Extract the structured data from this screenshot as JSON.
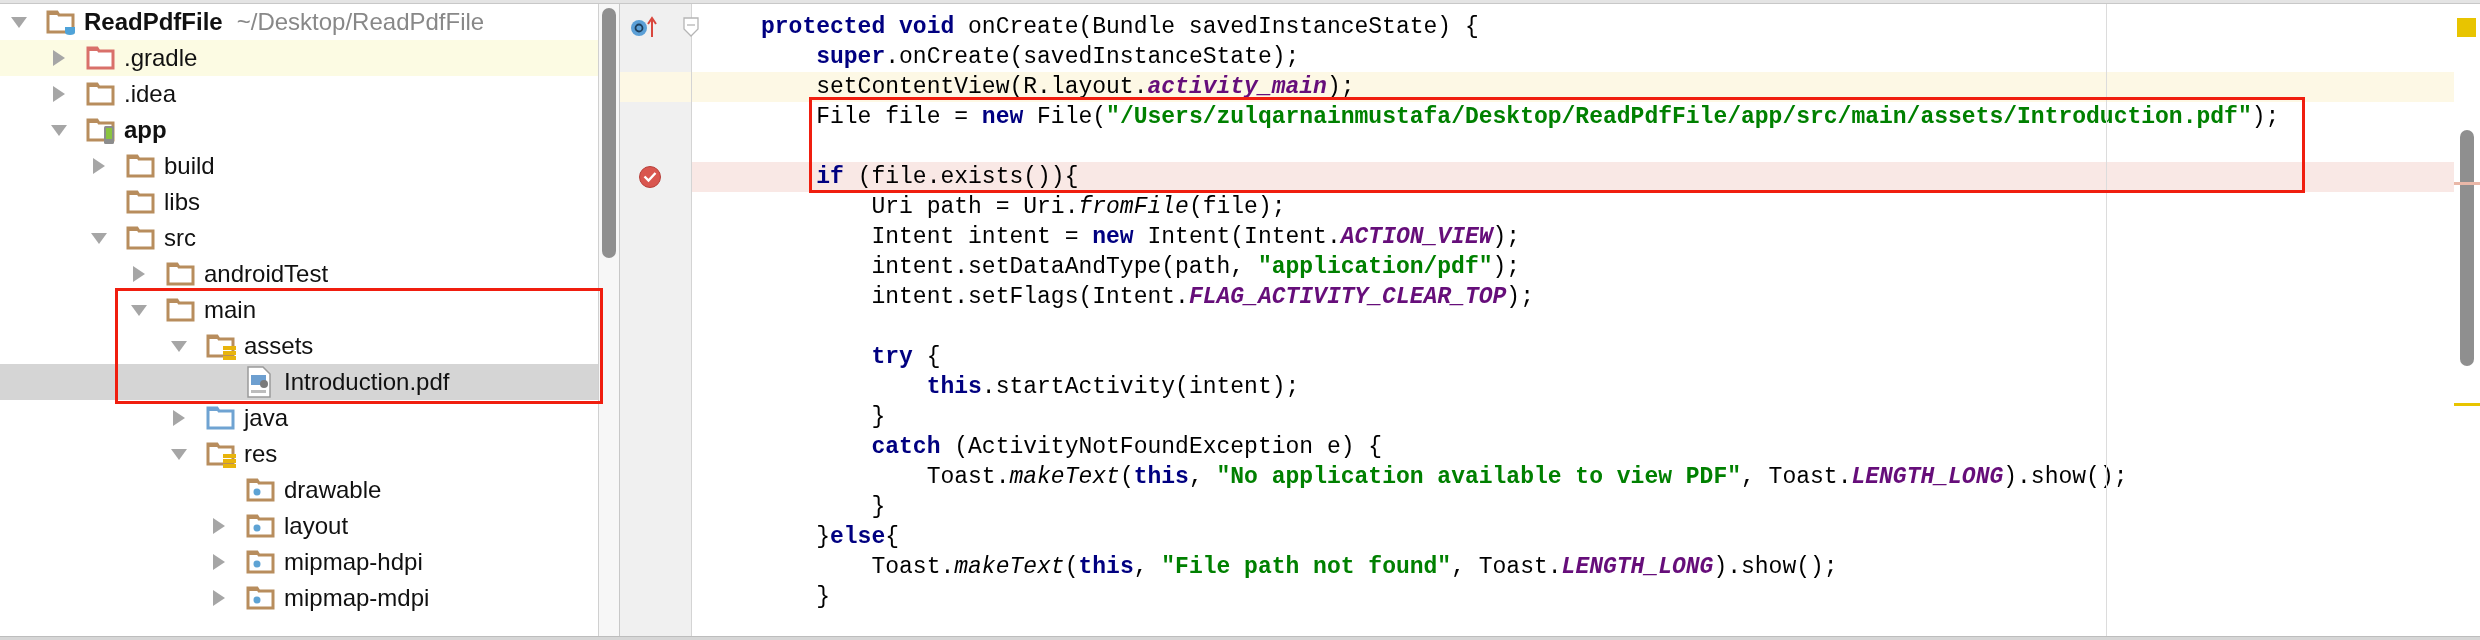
{
  "project_tree": [
    {
      "label": "ReadPdfFile",
      "path": "~/Desktop/ReadPdfFile",
      "kind": "project",
      "expanded": true,
      "selected": false,
      "highlighted": false,
      "boxed": false,
      "children": [
        {
          "label": ".gradle",
          "kind": "excluded",
          "expanded": false,
          "selected": false,
          "highlighted": true,
          "boxed": false
        },
        {
          "label": ".idea",
          "kind": "folder",
          "expanded": false,
          "selected": false,
          "highlighted": false,
          "boxed": false
        },
        {
          "label": "app",
          "kind": "module",
          "expanded": true,
          "selected": false,
          "highlighted": false,
          "boxed": false,
          "children": [
            {
              "label": "build",
              "kind": "folder",
              "expanded": false,
              "selected": false,
              "highlighted": false,
              "boxed": false
            },
            {
              "label": "libs",
              "kind": "folder",
              "selected": false,
              "highlighted": false,
              "boxed": false
            },
            {
              "label": "src",
              "kind": "folder",
              "expanded": true,
              "selected": false,
              "highlighted": false,
              "boxed": false,
              "children": [
                {
                  "label": "androidTest",
                  "kind": "folder",
                  "expanded": false,
                  "selected": false,
                  "highlighted": false,
                  "boxed": false
                },
                {
                  "label": "main",
                  "kind": "folder",
                  "expanded": true,
                  "selected": false,
                  "highlighted": false,
                  "boxed": true,
                  "children": [
                    {
                      "label": "assets",
                      "kind": "resources",
                      "expanded": true,
                      "selected": false,
                      "highlighted": false,
                      "boxed": true,
                      "children": [
                        {
                          "label": "Introduction.pdf",
                          "kind": "pdf",
                          "selected": true,
                          "highlighted": false,
                          "boxed": true
                        }
                      ]
                    },
                    {
                      "label": "java",
                      "kind": "source",
                      "expanded": false,
                      "selected": false,
                      "highlighted": false,
                      "boxed": false
                    },
                    {
                      "label": "res",
                      "kind": "resources",
                      "expanded": true,
                      "selected": false,
                      "highlighted": false,
                      "boxed": false,
                      "children": [
                        {
                          "label": "drawable",
                          "kind": "resdir",
                          "selected": false,
                          "highlighted": false,
                          "boxed": false
                        },
                        {
                          "label": "layout",
                          "kind": "resdir",
                          "expanded": false,
                          "selected": false,
                          "highlighted": false,
                          "boxed": false
                        },
                        {
                          "label": "mipmap-hdpi",
                          "kind": "resdir",
                          "expanded": false,
                          "selected": false,
                          "highlighted": false,
                          "boxed": false
                        },
                        {
                          "label": "mipmap-mdpi",
                          "kind": "resdir",
                          "expanded": false,
                          "selected": false,
                          "highlighted": false,
                          "boxed": false
                        }
                      ]
                    }
                  ]
                }
              ]
            }
          ]
        }
      ]
    }
  ],
  "editor": {
    "lines": [
      {
        "kind": "override",
        "boxed": false,
        "tokens": [
          {
            "text": "protected void",
            "kind": "keyword"
          },
          {
            "text": " onCreate(Bundle savedInstanceState) {",
            "kind": "plain"
          }
        ]
      },
      {
        "kind": "normal",
        "boxed": false,
        "tokens": [
          {
            "text": "    super",
            "kind": "keyword"
          },
          {
            "text": ".onCreate(savedInstanceState);",
            "kind": "plain"
          }
        ]
      },
      {
        "kind": "caret",
        "boxed": false,
        "tokens": [
          {
            "text": "    setContentView(R.layout.",
            "kind": "plain"
          },
          {
            "text": "activity_main",
            "kind": "field"
          },
          {
            "text": ");",
            "kind": "plain"
          }
        ]
      },
      {
        "kind": "normal",
        "boxed": true,
        "tokens": [
          {
            "text": "    File file = ",
            "kind": "plain"
          },
          {
            "text": "new",
            "kind": "keyword"
          },
          {
            "text": " File(",
            "kind": "plain"
          },
          {
            "text": "\"/Users/zulqarnainmustafa/Desktop/ReadPdfFile/app/src/main/assets/Introduction.pdf\"",
            "kind": "string"
          },
          {
            "text": ");",
            "kind": "plain"
          }
        ]
      },
      {
        "kind": "normal",
        "boxed": true
      },
      {
        "kind": "breakpoint",
        "boxed": true,
        "tokens": [
          {
            "text": "    if",
            "kind": "keyword"
          },
          {
            "text": " (file.exists()){",
            "kind": "plain"
          }
        ]
      },
      {
        "kind": "normal",
        "boxed": false,
        "tokens": [
          {
            "text": "        Uri path = Uri.",
            "kind": "plain"
          },
          {
            "text": "fromFile",
            "kind": "method"
          },
          {
            "text": "(file);",
            "kind": "plain"
          }
        ]
      },
      {
        "kind": "normal",
        "boxed": false,
        "tokens": [
          {
            "text": "        Intent intent = ",
            "kind": "plain"
          },
          {
            "text": "new",
            "kind": "keyword"
          },
          {
            "text": " Intent(Intent.",
            "kind": "plain"
          },
          {
            "text": "ACTION_VIEW",
            "kind": "field"
          },
          {
            "text": ");",
            "kind": "plain"
          }
        ]
      },
      {
        "kind": "normal",
        "boxed": false,
        "tokens": [
          {
            "text": "        intent.setDataAndType(path, ",
            "kind": "plain"
          },
          {
            "text": "\"application/pdf\"",
            "kind": "string"
          },
          {
            "text": ");",
            "kind": "plain"
          }
        ]
      },
      {
        "kind": "normal",
        "boxed": false,
        "tokens": [
          {
            "text": "        intent.setFlags(Intent.",
            "kind": "plain"
          },
          {
            "text": "FLAG_ACTIVITY_CLEAR_TOP",
            "kind": "field"
          },
          {
            "text": ");",
            "kind": "plain"
          }
        ]
      },
      {
        "kind": "normal"
      },
      {
        "kind": "normal",
        "boxed": false,
        "tokens": [
          {
            "text": "        try",
            "kind": "keyword"
          },
          {
            "text": " {",
            "kind": "plain"
          }
        ]
      },
      {
        "kind": "normal",
        "boxed": false,
        "tokens": [
          {
            "text": "            this",
            "kind": "keyword"
          },
          {
            "text": ".startActivity(intent);",
            "kind": "plain"
          }
        ]
      },
      {
        "kind": "normal",
        "boxed": false,
        "tokens": [
          {
            "text": "        }",
            "kind": "plain"
          }
        ]
      },
      {
        "kind": "normal",
        "boxed": false,
        "tokens": [
          {
            "text": "        catch",
            "kind": "keyword"
          },
          {
            "text": " (ActivityNotFoundException e) {",
            "kind": "plain"
          }
        ]
      },
      {
        "kind": "normal",
        "boxed": false,
        "tokens": [
          {
            "text": "            Toast.",
            "kind": "plain"
          },
          {
            "text": "makeText",
            "kind": "method"
          },
          {
            "text": "(",
            "kind": "plain"
          },
          {
            "text": "this",
            "kind": "keyword"
          },
          {
            "text": ", ",
            "kind": "plain"
          },
          {
            "text": "\"No application available to view PDF\"",
            "kind": "string"
          },
          {
            "text": ", Toast.",
            "kind": "plain"
          },
          {
            "text": "LENGTH_LONG",
            "kind": "field"
          },
          {
            "text": ").show();",
            "kind": "plain"
          }
        ]
      },
      {
        "kind": "normal",
        "boxed": false,
        "tokens": [
          {
            "text": "        }",
            "kind": "plain"
          }
        ]
      },
      {
        "kind": "normal",
        "boxed": false,
        "tokens": [
          {
            "text": "    }",
            "kind": "plain"
          },
          {
            "text": "else",
            "kind": "keyword"
          },
          {
            "text": "{",
            "kind": "plain"
          }
        ]
      },
      {
        "kind": "normal",
        "boxed": false,
        "tokens": [
          {
            "text": "        Toast.",
            "kind": "plain"
          },
          {
            "text": "makeText",
            "kind": "method"
          },
          {
            "text": "(",
            "kind": "plain"
          },
          {
            "text": "this",
            "kind": "keyword"
          },
          {
            "text": ", ",
            "kind": "plain"
          },
          {
            "text": "\"File path not found\"",
            "kind": "string"
          },
          {
            "text": ", Toast.",
            "kind": "plain"
          },
          {
            "text": "LENGTH_LONG",
            "kind": "field"
          },
          {
            "text": ").show();",
            "kind": "plain"
          }
        ]
      },
      {
        "kind": "normal",
        "boxed": false,
        "tokens": [
          {
            "text": "    }",
            "kind": "plain"
          }
        ]
      }
    ]
  }
}
